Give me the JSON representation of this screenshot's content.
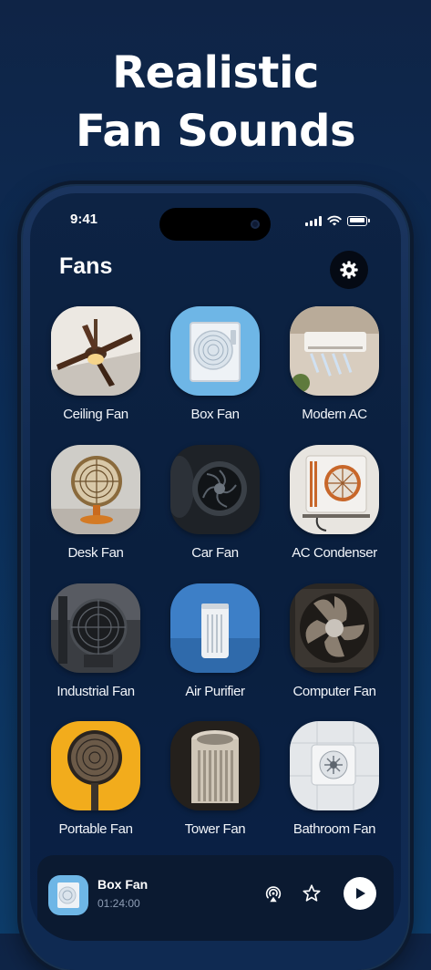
{
  "headline": {
    "line1": "Realistic",
    "line2": "Fan Sounds"
  },
  "status_bar": {
    "time": "9:41"
  },
  "screen": {
    "title": "Fans"
  },
  "fans": [
    {
      "label": "Ceiling Fan",
      "icon": "ceiling-fan-icon"
    },
    {
      "label": "Box Fan",
      "icon": "box-fan-icon"
    },
    {
      "label": "Modern AC",
      "icon": "modern-ac-icon"
    },
    {
      "label": "Desk Fan",
      "icon": "desk-fan-icon"
    },
    {
      "label": "Car Fan",
      "icon": "car-fan-icon"
    },
    {
      "label": "AC Condenser",
      "icon": "ac-condenser-icon"
    },
    {
      "label": "Industrial Fan",
      "icon": "industrial-fan-icon"
    },
    {
      "label": "Air Purifier",
      "icon": "air-purifier-icon"
    },
    {
      "label": "Computer Fan",
      "icon": "computer-fan-icon"
    },
    {
      "label": "Portable Fan",
      "icon": "portable-fan-icon"
    },
    {
      "label": "Tower Fan",
      "icon": "tower-fan-icon"
    },
    {
      "label": "Bathroom Fan",
      "icon": "bathroom-fan-icon"
    }
  ],
  "now_playing": {
    "title": "Box Fan",
    "time": "01:24:00"
  },
  "colors": {
    "background": "#0f2446",
    "player": "#0b1a31",
    "accent": "#ffffff"
  }
}
